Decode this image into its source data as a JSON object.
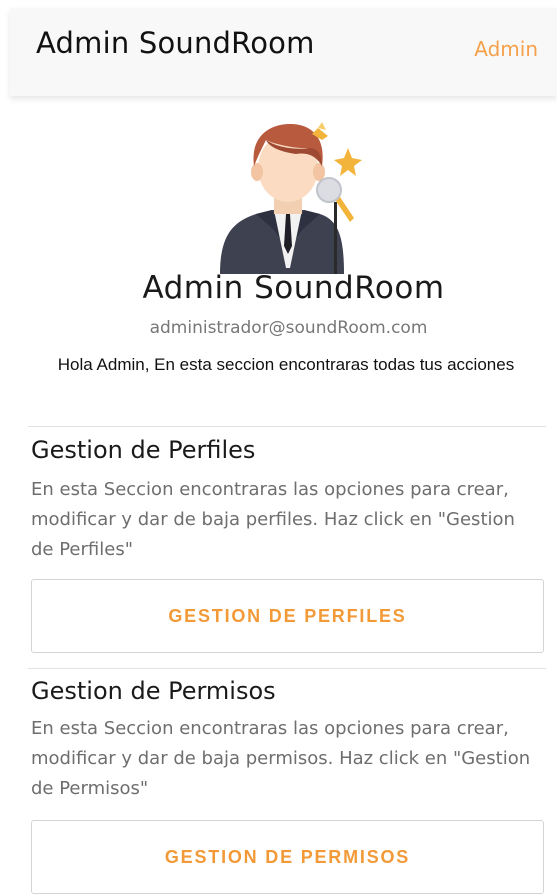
{
  "header": {
    "title": "Admin SoundRoom",
    "user_link": "Admin"
  },
  "profile": {
    "avatar_icon": "singer-avatar-icon",
    "name": "Admin SoundRoom",
    "email": "administrador@soundRoom.com",
    "welcome_message": "Hola Admin, En esta seccion encontraras todas tus acciones"
  },
  "sections": [
    {
      "title": "Gestion de Perfiles",
      "description": "En esta Seccion encontraras las opciones para crear, modificar y dar de baja perfiles. Haz  click en \"Gestion de Perfiles\"",
      "button_label": "GESTION DE PERFILES"
    },
    {
      "title": "Gestion de Permisos",
      "description": "En esta Seccion encontraras las opciones para crear, modificar y dar de baja permisos. Haz click en \"Gestion de Permisos\"",
      "button_label": "GESTION DE PERMISOS"
    }
  ],
  "colors": {
    "accent": "#f29a38",
    "link": "#f5a04a",
    "header_bg": "#f8f8f8"
  }
}
